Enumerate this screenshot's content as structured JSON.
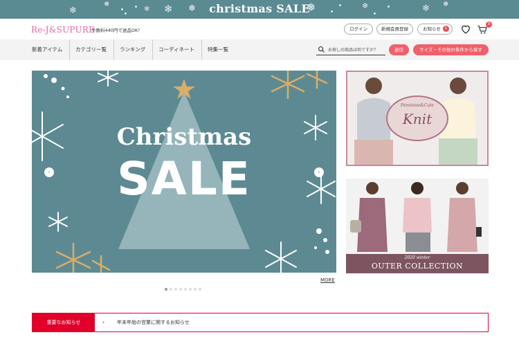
{
  "promo_banner": {
    "title": "christmas SALE"
  },
  "header": {
    "logo": "Re-J&SUPURE",
    "shipping_note": "手数料440円で送品OK！",
    "login": "ログイン",
    "register": "新規会員登録",
    "notifications": "お知らせ",
    "notification_count": "1",
    "cart_count": "0"
  },
  "nav": {
    "items": [
      "新着アイテム",
      "カテゴリー覧",
      "ランキング",
      "コーディネート",
      "特集一覧"
    ],
    "search_placeholder": "お探しの商品は何ですか？",
    "submit": "送信",
    "filter": "サイズ・その他の条件から探す"
  },
  "hero": {
    "line1": "Christmas",
    "line2": "SALE",
    "more": "MORE"
  },
  "side_promos": {
    "knit_small": "Feminine&Cute",
    "knit_main": "Knit",
    "outer_small": "2020 winter",
    "outer_main": "OUTER COLLECTION"
  },
  "notice": {
    "label": "重要なお知らせ",
    "text": "年末年始の営業に関するお知らせ"
  },
  "colors": {
    "teal": "#5a8a92",
    "pink": "#e6679a",
    "red": "#e0002a",
    "gold": "#c8a460"
  }
}
